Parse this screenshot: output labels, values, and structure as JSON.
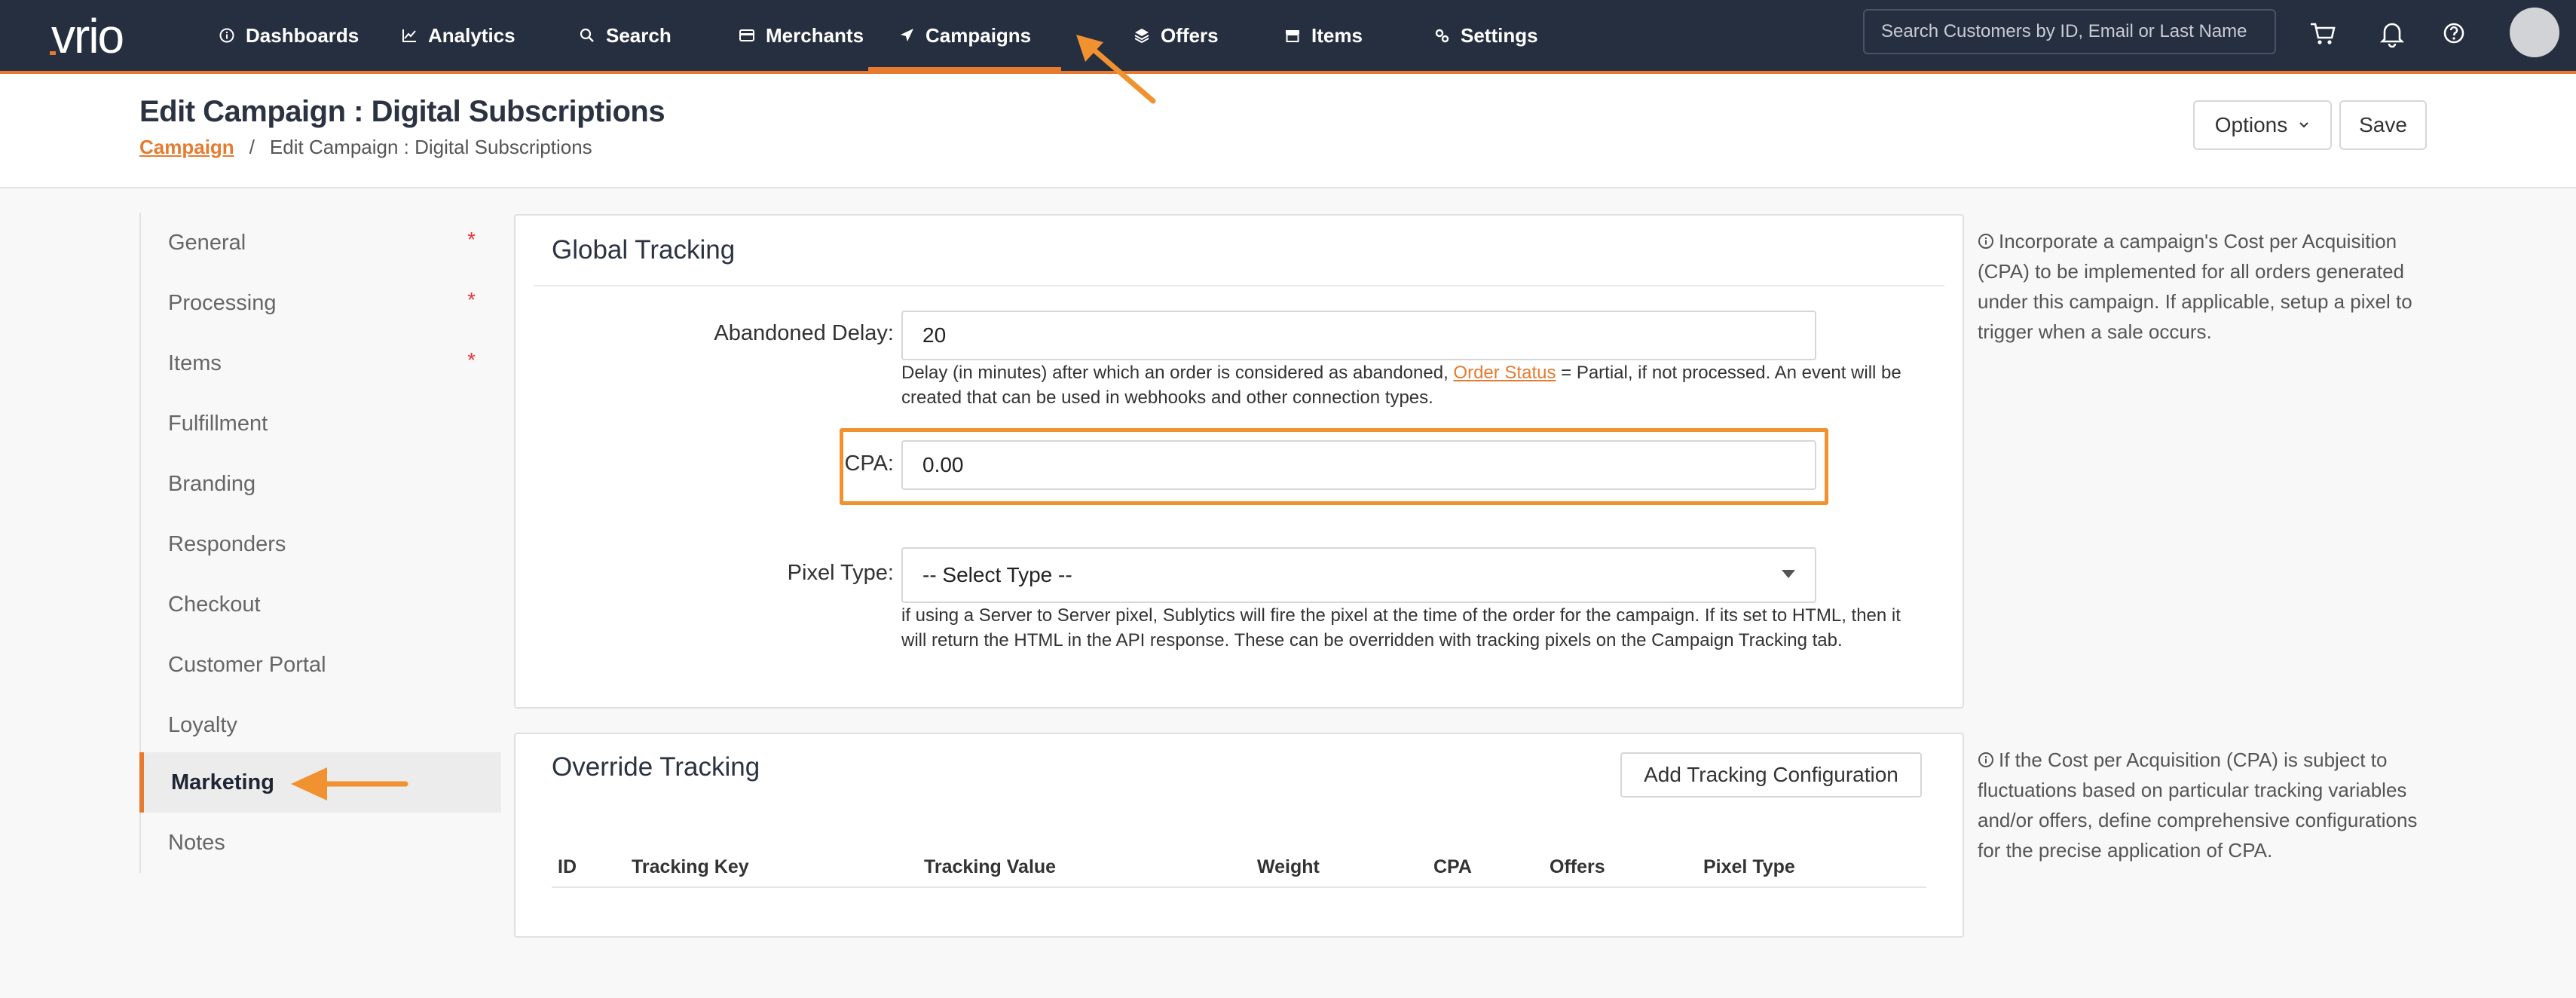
{
  "app": {
    "logo_text": "vrio",
    "colors": {
      "nav_bg": "#262f40",
      "accent": "#e67b2f",
      "highlight": "#f0922f"
    }
  },
  "nav": {
    "items": [
      {
        "label": "Dashboards",
        "icon": "info-circle-icon"
      },
      {
        "label": "Analytics",
        "icon": "line-chart-icon"
      },
      {
        "label": "Search",
        "icon": "search-icon"
      },
      {
        "label": "Merchants",
        "icon": "card-icon"
      },
      {
        "label": "Campaigns",
        "icon": "send-icon",
        "active": true
      },
      {
        "label": "Offers",
        "icon": "layers-icon"
      },
      {
        "label": "Items",
        "icon": "box-icon"
      },
      {
        "label": "Settings",
        "icon": "gears-icon"
      }
    ],
    "search_placeholder": "Search Customers by ID, Email or Last Name",
    "icons": [
      "cart-icon",
      "bell-icon",
      "help-icon",
      "avatar"
    ]
  },
  "header": {
    "title": "Edit Campaign : Digital Subscriptions",
    "breadcrumb": {
      "link": "Campaign",
      "separator": "/",
      "current": "Edit Campaign : Digital Subscriptions"
    },
    "options_label": "Options",
    "save_label": "Save"
  },
  "sidebar": {
    "items": [
      {
        "label": "General",
        "required": "*"
      },
      {
        "label": "Processing",
        "required": "*"
      },
      {
        "label": "Items",
        "required": "*"
      },
      {
        "label": "Fulfillment"
      },
      {
        "label": "Branding"
      },
      {
        "label": "Responders"
      },
      {
        "label": "Checkout"
      },
      {
        "label": "Customer Portal"
      },
      {
        "label": "Loyalty"
      },
      {
        "label": "Marketing",
        "active": true
      },
      {
        "label": "Notes"
      }
    ]
  },
  "global_tracking": {
    "title": "Global Tracking",
    "abandoned_delay": {
      "label": "Abandoned Delay:",
      "value": "20",
      "help_pre": "Delay (in minutes) after which an order is considered as abandoned, ",
      "help_link": "Order Status",
      "help_post": " = Partial, if not processed. An event will be created that can be used in webhooks and other connection types."
    },
    "cpa": {
      "label": "CPA:",
      "value": "0.00"
    },
    "pixel_type": {
      "label": "Pixel Type:",
      "selected": "-- Select Type --",
      "help": "if using a Server to Server pixel, Sublytics will fire the pixel at the time of the order for the campaign. If its set to HTML, then it will return the HTML in the API response. These can be overridden with tracking pixels on the Campaign Tracking tab."
    },
    "info": "Incorporate a campaign's Cost per Acquisition (CPA) to be implemented for all orders generated under this campaign. If applicable, setup a pixel to trigger when a sale occurs."
  },
  "override_tracking": {
    "title": "Override Tracking",
    "add_label": "Add Tracking Configuration",
    "columns": [
      "ID",
      "Tracking Key",
      "Tracking Value",
      "Weight",
      "CPA",
      "Offers",
      "Pixel Type"
    ],
    "info": "If the Cost per Acquisition (CPA) is subject to fluctuations based on particular tracking variables and/or offers, define comprehensive configurations for the precise application of CPA."
  }
}
